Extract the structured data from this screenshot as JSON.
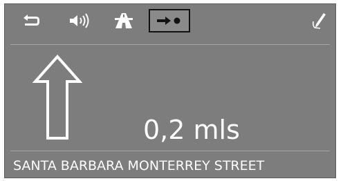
{
  "toolbar": {
    "buttons": [
      {
        "icon": "return-arrow-icon",
        "active": false
      },
      {
        "icon": "speaker-volume-icon",
        "active": false
      },
      {
        "icon": "motorway-icon",
        "active": false
      },
      {
        "icon": "arrow-to-destination-icon",
        "active": true
      },
      {
        "icon": "pen-edit-icon",
        "active": false
      }
    ]
  },
  "guidance": {
    "direction_icon": "straight-up-arrow-icon",
    "distance": "0,2 mls",
    "street": "SANTA BARBARA MONTERREY STREET"
  },
  "colors": {
    "background": "#7d7d7d",
    "text": "#ffffff",
    "active_border": "#111111"
  }
}
